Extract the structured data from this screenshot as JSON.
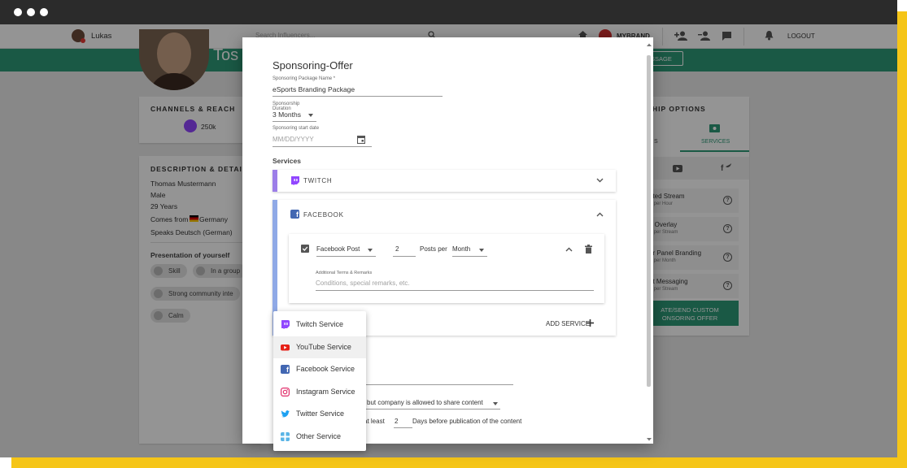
{
  "topnav": {
    "user_name": "Lukas",
    "search_placeholder": "Search Influencers...",
    "brand": "MYBRAND",
    "logout": "LOGOUT"
  },
  "profile": {
    "name_partial": "Tos",
    "message_btn": "SSAGE"
  },
  "channels": {
    "title": "CHANNELS & REACH",
    "twitch_count": "250k"
  },
  "description": {
    "title": "DESCRIPTION & DETAILS",
    "lines": [
      "Thomas Mustermann",
      "Male",
      "29 Years",
      "Comes from",
      "Germany",
      "Speaks Deutsch (German)"
    ],
    "presentation_title": "Presentation of yourself",
    "chips": [
      "Skill",
      "In a group",
      "Strong community inte",
      "Calm"
    ]
  },
  "sponsor_options": {
    "title_partial": "HIP OPTIONS",
    "tab_services": "SERVICES",
    "tab_left_partial": "S",
    "items": [
      {
        "title": "ated Stream",
        "sub": "K per Hour"
      },
      {
        "title": "n Overlay",
        "sub": "K per Stream"
      },
      {
        "title": "er Panel Branding",
        "sub": "K per Month"
      },
      {
        "title": "ot Messaging",
        "sub": "K per Stream"
      }
    ],
    "cta_line1": "ATE/SEND CUSTOM",
    "cta_line2": "ONSORING OFFER"
  },
  "modal": {
    "title": "Sponsoring-Offer",
    "package_label": "Sponsoring Package Name *",
    "package_value": "eSports Branding Package",
    "duration_label_1": "Sponsorship",
    "duration_label_2": "Duration",
    "duration_value": "3 Months",
    "start_label": "Sponsoring start date",
    "start_placeholder": "MM/DD/YYYY",
    "services_title": "Services",
    "twitch_label": "TWITCH",
    "facebook_label": "FACEBOOK",
    "fb_post_type": "Facebook Post",
    "fb_count": "2",
    "posts_per": "Posts per",
    "period": "Month",
    "terms_label": "Additional Terms & Remarks",
    "terms_placeholder": "Conditions, special remarks, etc.",
    "add_service": "ADD SERVICE",
    "rights_text": "but company is allowed to share content",
    "at_least": "at least",
    "days_value": "2",
    "days_text": "Days before publication of the content"
  },
  "service_menu": {
    "items": [
      "Twitch Service",
      "YouTube Service",
      "Facebook Service",
      "Instagram Service",
      "Twitter Service",
      "Other Service"
    ]
  },
  "colors": {
    "accent_green": "#2e9a78",
    "twitch": "#9146ff",
    "facebook": "#4267b2",
    "youtube": "#e62117",
    "instagram": "#e1306c",
    "twitter": "#1da1f2",
    "other": "#5ab4e6",
    "highlight_yellow": "#f5c518"
  }
}
